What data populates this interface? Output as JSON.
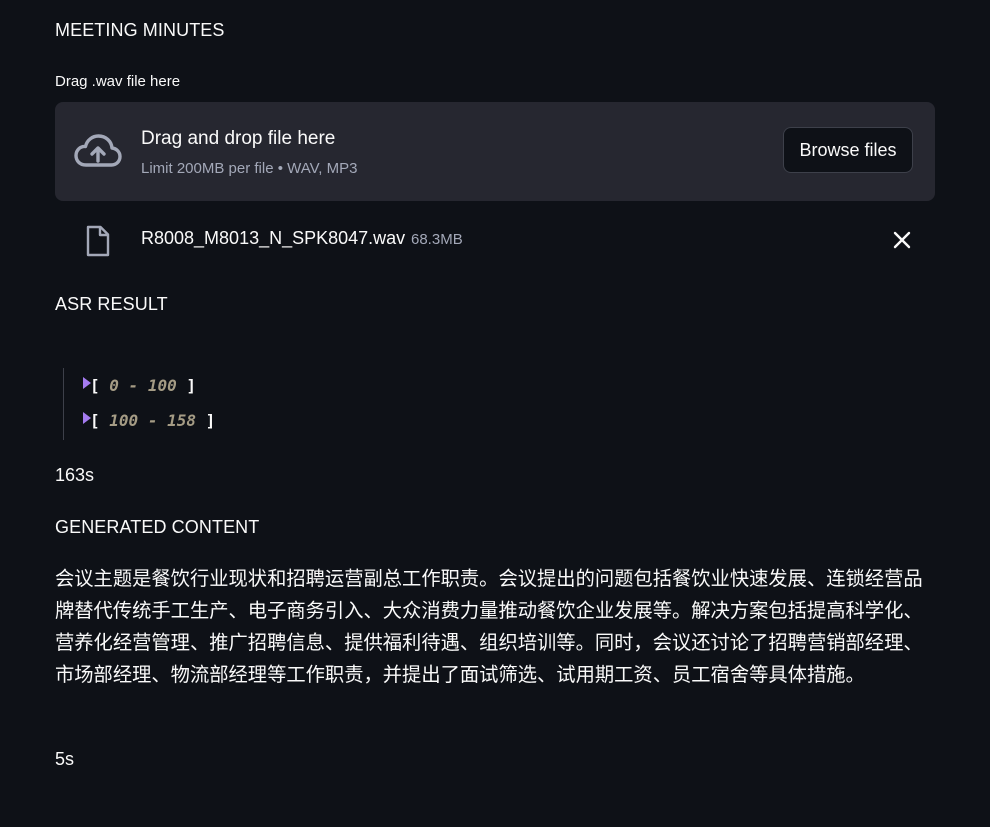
{
  "headings": {
    "meeting_minutes": "MEETING MINUTES",
    "asr_result": "ASR RESULT",
    "generated_content": "GENERATED CONTENT"
  },
  "uploader": {
    "label": "Drag .wav file here",
    "drop_title": "Drag and drop file here",
    "drop_subtitle": "Limit 200MB per file • WAV, MP3",
    "browse_label": "Browse files",
    "icon": "cloud-upload-icon"
  },
  "uploaded_file": {
    "name": "R8008_M8013_N_SPK8047.wav",
    "size": "68.3MB",
    "icon": "file-icon",
    "remove_icon": "close-icon"
  },
  "asr": {
    "segments": [
      {
        "open": "[",
        "range": "0 - 100",
        "close": "]"
      },
      {
        "open": "[",
        "range": "100 - 158",
        "close": "]"
      }
    ],
    "time": "163s"
  },
  "generated": {
    "text": "会议主题是餐饮行业现状和招聘运营副总工作职责。会议提出的问题包括餐饮业快速发展、连锁经营品牌替代传统手工生产、电子商务引入、大众消费力量推动餐饮企业发展等。解决方案包括提高科学化、营养化经营管理、推广招聘信息、提供福利待遇、组织培训等。同时，会议还讨论了招聘营销部经理、市场部经理、物流部经理等工作职责，并提出了面试筛选、试用期工资、员工宿舍等具体措施。",
    "time": "5s"
  },
  "colors": {
    "background": "#0e1117",
    "dropzone": "#262730",
    "caret": "#a47bf0",
    "range_text": "#a59c85",
    "muted_text": "#a3a8b8"
  }
}
